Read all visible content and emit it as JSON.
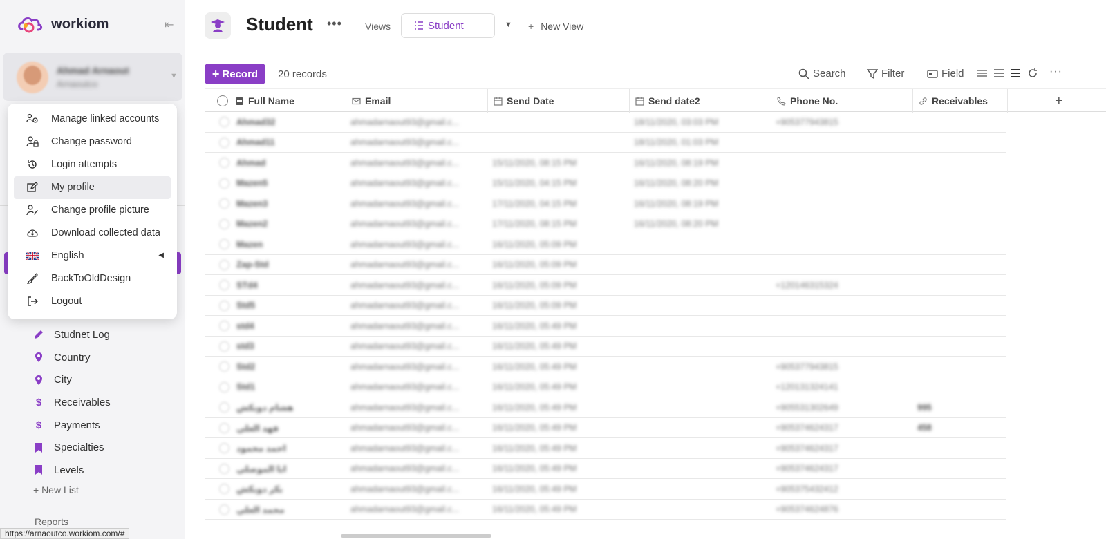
{
  "app": {
    "name": "workiom",
    "status_url": "https://arnaoutco.workiom.com/#"
  },
  "user": {
    "name": "Ahmad Arnaout",
    "subtitle": "Arnaoutco"
  },
  "menu": [
    {
      "label": "Manage linked accounts",
      "icon": "linked-accounts-icon"
    },
    {
      "label": "Change password",
      "icon": "user-lock-icon"
    },
    {
      "label": "Login attempts",
      "icon": "history-icon"
    },
    {
      "label": "My profile",
      "icon": "edit-icon",
      "highlighted": true
    },
    {
      "label": "Change profile picture",
      "icon": "user-edit-icon"
    },
    {
      "label": "Download collected data",
      "icon": "cloud-download-icon"
    },
    {
      "label": "English",
      "icon": "uk-flag-icon",
      "submenu": true
    },
    {
      "label": "BackToOldDesign",
      "icon": "brush-icon"
    },
    {
      "label": "Logout",
      "icon": "logout-icon"
    }
  ],
  "sidebar": {
    "lists": [
      {
        "label": "Studnet Log",
        "icon": "pencil-icon"
      },
      {
        "label": "Country",
        "icon": "location-pin-icon"
      },
      {
        "label": "City",
        "icon": "location-pin-icon"
      },
      {
        "label": "Receivables",
        "icon": "dollar-icon"
      },
      {
        "label": "Payments",
        "icon": "dollar-icon"
      },
      {
        "label": "Specialties",
        "icon": "bookmark-icon"
      },
      {
        "label": "Levels",
        "icon": "bookmark-icon"
      }
    ],
    "new_list": "+ New List",
    "reports": "Reports"
  },
  "header": {
    "title": "Student",
    "views_label": "Views",
    "active_view": "Student",
    "new_view": "New View"
  },
  "toolbar": {
    "record_button": "Record",
    "records_count": "20 records",
    "search": "Search",
    "filter": "Filter",
    "field": "Field"
  },
  "table": {
    "columns": [
      {
        "label": "Full Name",
        "icon": "name-field-icon"
      },
      {
        "label": "Email",
        "icon": "mail-icon"
      },
      {
        "label": "Send Date",
        "icon": "calendar-icon"
      },
      {
        "label": "Send date2",
        "icon": "calendar-icon"
      },
      {
        "label": "Phone No.",
        "icon": "phone-icon"
      },
      {
        "label": "Receivables",
        "icon": "link-icon"
      }
    ],
    "rows": [
      [
        "Ahmad32",
        "ahmadarnaout93@gmail.c...",
        "",
        "18/11/2020, 03:03 PM",
        "+905377943815",
        ""
      ],
      [
        "Ahmad11",
        "ahmadarnaout93@gmail.c...",
        "",
        "18/11/2020, 01:03 PM",
        "",
        ""
      ],
      [
        "Ahmad",
        "ahmadarnaout93@gmail.c...",
        "15/11/2020, 08:15 PM",
        "16/11/2020, 08:19 PM",
        "",
        ""
      ],
      [
        "Mazen5",
        "ahmadarnaout93@gmail.c...",
        "15/11/2020, 04:15 PM",
        "16/11/2020, 08:20 PM",
        "",
        ""
      ],
      [
        "Mazen3",
        "ahmadarnaout93@gmail.c...",
        "17/11/2020, 04:15 PM",
        "16/11/2020, 08:19 PM",
        "",
        ""
      ],
      [
        "Mazen2",
        "ahmadarnaout93@gmail.c...",
        "17/11/2020, 08:15 PM",
        "16/11/2020, 08:20 PM",
        "",
        ""
      ],
      [
        "Mazen",
        "ahmadarnaout93@gmail.c...",
        "16/11/2020, 05:09 PM",
        "",
        "",
        ""
      ],
      [
        "Zap-Std",
        "ahmadarnaout93@gmail.c...",
        "16/11/2020, 05:09 PM",
        "",
        "",
        ""
      ],
      [
        "STd4",
        "ahmadarnaout93@gmail.c...",
        "16/11/2020, 05:09 PM",
        "",
        "+120146315324",
        ""
      ],
      [
        "Std5",
        "ahmadarnaout93@gmail.c...",
        "16/11/2020, 05:09 PM",
        "",
        "",
        ""
      ],
      [
        "std4",
        "ahmadarnaout93@gmail.c...",
        "16/11/2020, 05:49 PM",
        "",
        "",
        ""
      ],
      [
        "std3",
        "ahmadarnaout93@gmail.c...",
        "16/11/2020, 05:49 PM",
        "",
        "",
        ""
      ],
      [
        "Std2",
        "ahmadarnaout93@gmail.c...",
        "16/11/2020, 05:49 PM",
        "",
        "+905377943815",
        ""
      ],
      [
        "Std1",
        "ahmadarnaout93@gmail.c...",
        "16/11/2020, 05:49 PM",
        "",
        "+120131324141",
        ""
      ],
      [
        "هشام دوبكش",
        "ahmadarnaout93@gmail.c...",
        "16/11/2020, 05:49 PM",
        "",
        "+905531302649",
        "995"
      ],
      [
        "فهد العلي",
        "ahmadarnaout93@gmail.c...",
        "16/11/2020, 05:49 PM",
        "",
        "+905374624317",
        "458"
      ],
      [
        "احمد محمود",
        "ahmadarnaout93@gmail.c...",
        "16/11/2020, 05:49 PM",
        "",
        "+905374624317",
        ""
      ],
      [
        "ابا الموصلي",
        "ahmadarnaout93@gmail.c...",
        "16/11/2020, 05:49 PM",
        "",
        "+905374624317",
        ""
      ],
      [
        "بكر دوبكش",
        "ahmadarnaout93@gmail.c...",
        "16/11/2020, 05:49 PM",
        "",
        "+905375432412",
        ""
      ],
      [
        "محمد العلي",
        "ahmadarnaout93@gmail.c...",
        "16/11/2020, 05:49 PM",
        "",
        "+905374624876",
        ""
      ]
    ]
  },
  "colors": {
    "accent": "#8a3ec6",
    "sidebar_bg": "#f4f4f6"
  }
}
